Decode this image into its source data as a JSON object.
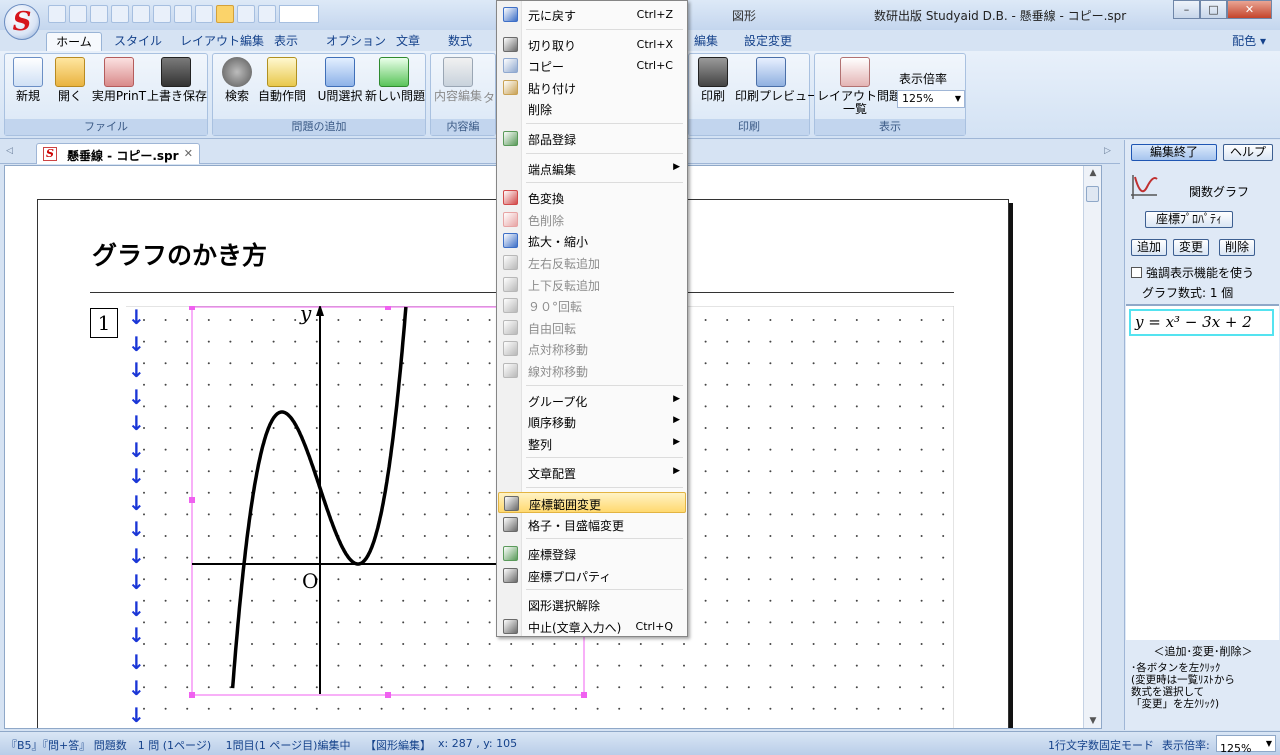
{
  "app": {
    "orb_letter": "S",
    "window_title": "数研出版 Studyaid D.B. - 懸垂線 - コピー.spr",
    "context_tab": "図形",
    "min": "–",
    "max": "□",
    "close": "✕"
  },
  "ribbon_tabs": [
    "ホーム",
    "スタイル",
    "レイアウト編集",
    "表示",
    "オプション",
    "文章",
    "数式",
    "編集",
    "設定変更"
  ],
  "ribbon_right": "配色 ▾",
  "ribbon": {
    "file": {
      "label": "ファイル",
      "new": "新規",
      "open": "開く",
      "print_t": "実用PrinT",
      "save": "上書き保存"
    },
    "add": {
      "label": "問題の追加",
      "search": "検索",
      "auto": "自動作問",
      "uselect": "U問選択",
      "newq": "新しい問題"
    },
    "content": {
      "label": "内容編",
      "edit": "内容編集",
      "other": "タ"
    },
    "print": {
      "label": "印刷",
      "print": "印刷",
      "preview": "印刷プレビュー"
    },
    "view": {
      "label": "表示",
      "layout": "レイアウト問題\n一覧",
      "zoom_label": "表示倍率",
      "zoom_value": "125%"
    }
  },
  "doc_tab": {
    "name": "懸垂線 - コピー.spr",
    "close": "✕"
  },
  "document": {
    "title": "グラフのかき方",
    "question_number": "1",
    "arrow_glyph": "↓",
    "graph": {
      "y_label": "y",
      "origin_label": "O",
      "equation": "y = x^3 - 3x + 2"
    }
  },
  "right_panel": {
    "finish_button": "編集終了",
    "help_button": "ヘルプ",
    "object_type": "関数グラフ",
    "coord_props_button": "座標ﾌﾟﾛﾊﾟﾃｨ",
    "add_button": "追加",
    "change_button": "変更",
    "delete_button": "削除",
    "highlight_checkbox": "強調表示機能を使う",
    "formula_count": "グラフ数式:  1 個",
    "formula_item": "y = x³ − 3x + 2",
    "footer_title": "＜追加･変更･削除＞",
    "footer_lines": [
      "･各ボタンを左ｸﾘｯｸ",
      "(変更時は一覧ﾘｽﾄから",
      "    数式を選択して",
      "      「変更」を左ｸﾘｯｸ)"
    ]
  },
  "context_menu": [
    {
      "label": "元に戻す",
      "shortcut": "Ctrl+Z",
      "icon": "undo-icon",
      "color": "#3d6fc7"
    },
    {
      "sep": true
    },
    {
      "label": "切り取り",
      "shortcut": "Ctrl+X",
      "icon": "cut-icon",
      "color": "#6a6a6a"
    },
    {
      "label": "コピー",
      "shortcut": "Ctrl+C",
      "icon": "copy-icon",
      "color": "#8fa8cf"
    },
    {
      "label": "貼り付け",
      "icon": "paste-icon",
      "color": "#c9a255"
    },
    {
      "label": "削除",
      "icon": "",
      "color": ""
    },
    {
      "sep": true
    },
    {
      "label": "部品登録",
      "icon": "parts-register-icon",
      "color": "#5a9a5a"
    },
    {
      "sep": true
    },
    {
      "label": "端点編集",
      "submenu": true,
      "icon": "",
      "color": ""
    },
    {
      "sep": true
    },
    {
      "label": "色変換",
      "icon": "color-convert-icon",
      "color": "#d24a4a"
    },
    {
      "label": "色削除",
      "disabled": true,
      "icon": "color-delete-icon",
      "color": "#e7a4a4"
    },
    {
      "label": "拡大・縮小",
      "icon": "scale-icon",
      "color": "#3d6fc7"
    },
    {
      "label": "左右反転追加",
      "disabled": true,
      "icon": "flip-h-icon",
      "color": "#b8b8b8"
    },
    {
      "label": "上下反転追加",
      "disabled": true,
      "icon": "flip-v-icon",
      "color": "#b8b8b8"
    },
    {
      "label": "９０°回転",
      "disabled": true,
      "icon": "rotate90-icon",
      "color": "#b8b8b8"
    },
    {
      "label": "自由回転",
      "disabled": true,
      "icon": "rotate-free-icon",
      "color": "#b8b8b8"
    },
    {
      "label": "点対称移動",
      "disabled": true,
      "icon": "point-symmetry-icon",
      "color": "#b8b8b8"
    },
    {
      "label": "線対称移動",
      "disabled": true,
      "icon": "line-symmetry-icon",
      "color": "#b8b8b8"
    },
    {
      "sep": true
    },
    {
      "label": "グループ化",
      "submenu": true,
      "icon": "",
      "color": ""
    },
    {
      "label": "順序移動",
      "submenu": true,
      "icon": "",
      "color": ""
    },
    {
      "label": "整列",
      "submenu": true,
      "icon": "",
      "color": ""
    },
    {
      "sep": true
    },
    {
      "label": "文章配置",
      "submenu": true,
      "icon": "",
      "color": ""
    },
    {
      "sep": true
    },
    {
      "label": "座標範囲変更",
      "highlight": true,
      "icon": "coord-range-icon",
      "color": "#6a6a6a"
    },
    {
      "label": "格子・目盛幅変更",
      "icon": "grid-icon",
      "color": "#6a6a6a"
    },
    {
      "sep": true
    },
    {
      "label": "座標登録",
      "icon": "coord-register-icon",
      "color": "#5a9a5a"
    },
    {
      "label": "座標プロパティ",
      "icon": "coord-props-icon",
      "color": "#6a6a6a"
    },
    {
      "sep": true
    },
    {
      "label": "図形選択解除",
      "icon": "",
      "color": ""
    },
    {
      "label": "中止(文章入力へ)",
      "shortcut": "Ctrl+Q",
      "icon": "stop-icon",
      "color": "#6a6a6a"
    }
  ],
  "status_bar": {
    "left": "『B5』『問+答』 問題数　1 問 (1ページ)　 1問目(1 ページ目)編集中　 【図形編集】",
    "coords": "x: 287 , y: 105",
    "mode": "1行文字数固定モード",
    "zoom_label": "表示倍率:",
    "zoom_value": "125%"
  }
}
